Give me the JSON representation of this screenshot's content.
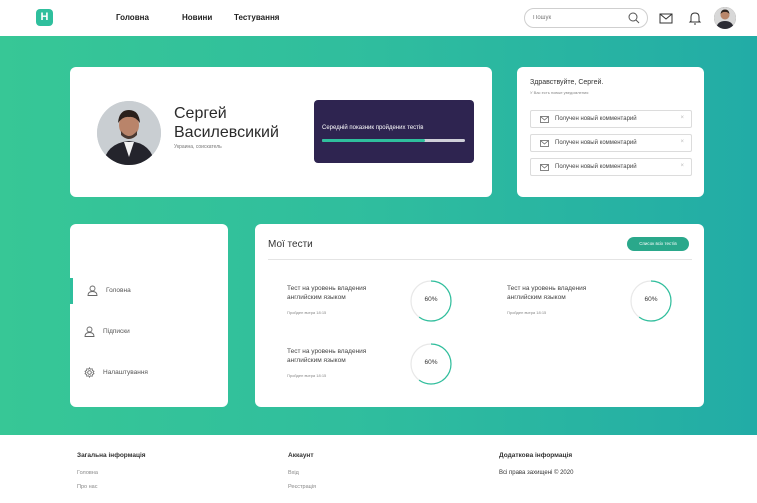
{
  "header": {
    "logo_text": "H",
    "nav": [
      "Головна",
      "Новини",
      "Тестування"
    ],
    "search_placeholder": "Пошук",
    "icons": [
      "search-icon",
      "mail-icon",
      "bell-icon"
    ]
  },
  "profile": {
    "name": "Сергей Василевсикий",
    "subtitle": "Украина, соискатель",
    "stat_label": "Середній показник пройдених тестів",
    "stat_progress": 0.72
  },
  "notifications": {
    "greeting": "Здравствуйте, Сергей.",
    "subtext": "У Вас есть новые уведомления",
    "items": [
      "Получен новый комментарий",
      "Получен новый комментарий",
      "Получен новый комментарий"
    ]
  },
  "sidebar": {
    "items": [
      {
        "label": "Головна",
        "icon": "user-icon",
        "active": true
      },
      {
        "label": "Підписки",
        "icon": "user-icon",
        "active": false
      },
      {
        "label": "Налаштування",
        "icon": "gear-icon",
        "active": false
      }
    ]
  },
  "tests": {
    "title": "Мої тести",
    "all_button": "Список всіх тестів",
    "items": [
      {
        "title": "Тест на уровень владения английским языком",
        "date": "Пройден вчера 18:15",
        "percent_label": "60%",
        "percent": 0.6
      },
      {
        "title": "Тест на уровень владения английским языком",
        "date": "Пройден вчера 18:15",
        "percent_label": "60%",
        "percent": 0.6
      },
      {
        "title": "Тест на уровень владения английским языком",
        "date": "Пройден вчера 18:15",
        "percent_label": "60%",
        "percent": 0.6
      }
    ]
  },
  "footer": {
    "general": {
      "heading": "Загальна інформація",
      "links": [
        "Головна",
        "Про нас"
      ]
    },
    "account": {
      "heading": "Аккаунт",
      "links": [
        "Вхід",
        "Реєстрація"
      ]
    },
    "extra": {
      "heading": "Додаткова інформація",
      "text": "Всі права захищені © 2020"
    }
  },
  "colors": {
    "accent": "#2fbf9d",
    "band_start": "#37c796",
    "band_end": "#22aca6",
    "stat_bg": "#2e2450"
  }
}
